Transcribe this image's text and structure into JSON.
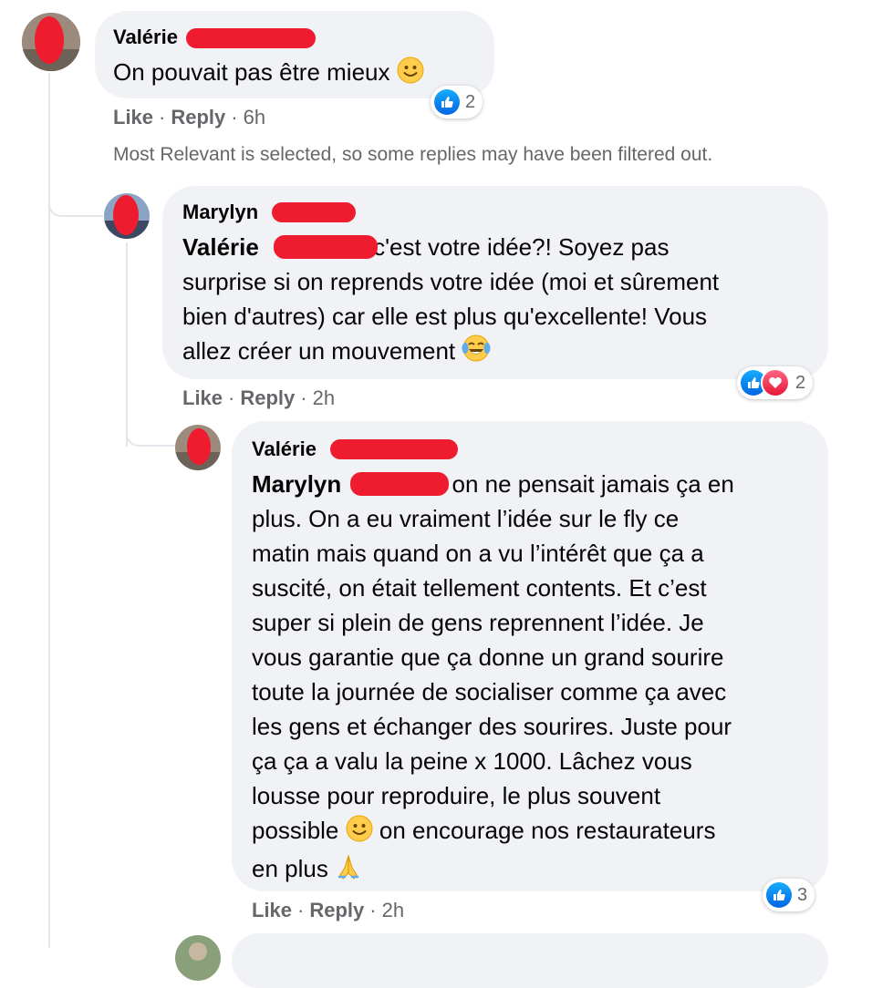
{
  "comments": [
    {
      "author": "Valérie",
      "text": "On pouvait pas être mieux",
      "emoji_name": "slightly-smiling-face-emoji",
      "reaction_count": "2",
      "reaction_types": [
        "like"
      ],
      "actions": {
        "like": "Like",
        "reply": "Reply",
        "time": "6h"
      }
    },
    {
      "author": "Marylyn",
      "mention": "Valérie",
      "text_lines": [
        "c'est votre idée?! Soyez pas",
        "surprise si on reprends votre idée (moi et sûrement",
        "bien d'autres) car elle est plus qu'excellente! Vous",
        "allez créer un mouvement"
      ],
      "emoji_name": "tears-of-joy-emoji",
      "reaction_count": "2",
      "reaction_types": [
        "like",
        "love"
      ],
      "actions": {
        "like": "Like",
        "reply": "Reply",
        "time": "2h"
      }
    },
    {
      "author": "Valérie",
      "mention": "Marylyn",
      "text_lines": [
        "on ne pensait jamais ça en",
        "plus. On a eu vraiment l’idée sur le fly ce",
        "matin mais quand on a vu l’intérêt que ça a",
        "suscité, on était tellement contents. Et c’est",
        "super si plein de gens reprennent l’idée. Je",
        "vous garantie que ça donne un grand sourire",
        "toute la journée de socialiser comme ça avec",
        "les gens et échanger des sourires. Juste pour",
        "ça ça a valu la peine x 1000. Lâchez vous",
        "lousse pour reproduire, le plus souvent",
        "possible",
        "on encourage nos restaurateurs",
        "en plus"
      ],
      "reaction_count": "3",
      "reaction_types": [
        "like"
      ],
      "actions": {
        "like": "Like",
        "reply": "Reply",
        "time": "2h"
      }
    }
  ],
  "filter_notice": "Most Relevant is selected, so some replies may have been filtered out.",
  "colors": {
    "bubble": "#f0f2f5",
    "secondary_text": "#65676b",
    "redaction": "#ee1c2e",
    "like_blue": "#0866ff",
    "love_red": "#f33e58"
  }
}
